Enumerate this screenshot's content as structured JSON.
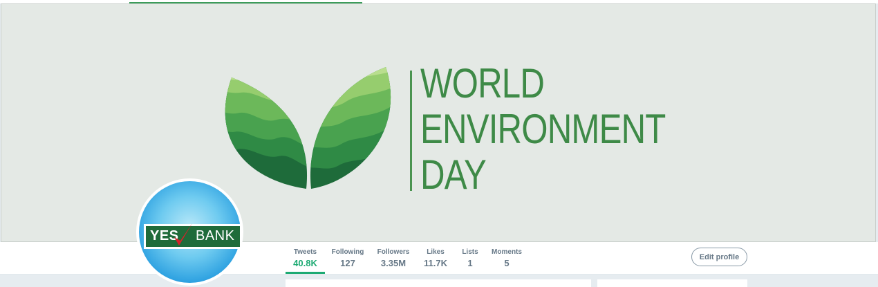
{
  "banner": {
    "title_lines": [
      "WORLD",
      "ENVIRONMENT",
      "DAY"
    ],
    "colors": {
      "text": "#3e8a47",
      "background": "#e4e9e5"
    }
  },
  "profile": {
    "avatar_logo": {
      "left": "YES",
      "right": "BANK"
    }
  },
  "nav": {
    "stats": [
      {
        "label": "Tweets",
        "value": "40.8K",
        "active": true
      },
      {
        "label": "Following",
        "value": "127"
      },
      {
        "label": "Followers",
        "value": "3.35M"
      },
      {
        "label": "Likes",
        "value": "11.7K"
      },
      {
        "label": "Lists",
        "value": "1"
      },
      {
        "label": "Moments",
        "value": "5"
      }
    ],
    "edit_profile_label": "Edit profile"
  },
  "colors": {
    "accent": "#1daa73",
    "muted_text": "#657786",
    "page_bg": "#e6ecf0"
  }
}
